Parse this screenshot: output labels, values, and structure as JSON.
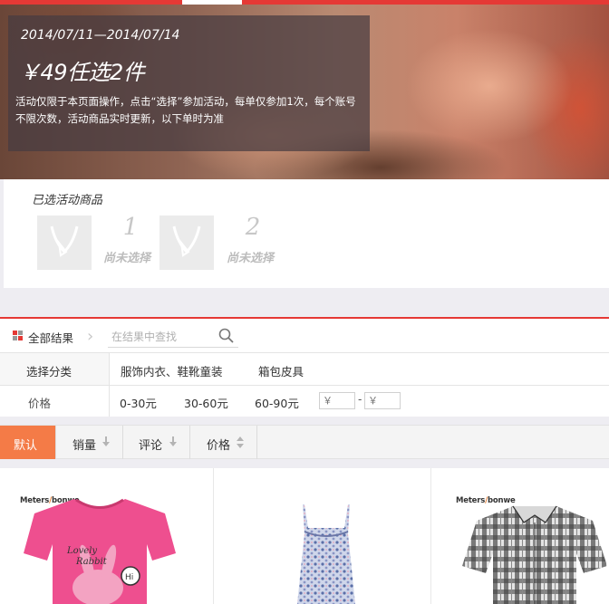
{
  "banner": {
    "date_range": "2014/07/11—2014/07/14",
    "title": "￥49任选2件",
    "description": "活动仅限于本页面操作，点击“选择”参加活动，每单仅参加1次，每个账号不限次数，活动商品实时更新，以下单时为准"
  },
  "selected": {
    "label": "已选活动商品",
    "slots": [
      {
        "number": "1",
        "status": "尚未选择"
      },
      {
        "number": "2",
        "status": "尚未选择"
      }
    ]
  },
  "filter": {
    "all_results": "全部结果",
    "search_placeholder": "在结果中查找",
    "category_label": "选择分类",
    "categories": [
      "服饰内衣、鞋靴童装",
      "箱包皮具"
    ],
    "price_label": "价格",
    "price_ranges": [
      "0-30元",
      "30-60元",
      "60-90元"
    ],
    "price_min_placeholder": "￥",
    "price_max_placeholder": "￥",
    "price_dash": "-"
  },
  "sort": {
    "buttons": [
      {
        "label": "默认",
        "active": true
      },
      {
        "label": "销量",
        "active": false
      },
      {
        "label": "评论",
        "active": false
      },
      {
        "label": "价格",
        "active": false
      }
    ]
  },
  "products": [
    {
      "brand": "Meters/bonwe",
      "item": "pink-t-shirt"
    },
    {
      "brand": "",
      "item": "floral-dress"
    },
    {
      "brand": "Meters/bonwe",
      "item": "plaid-shirt"
    }
  ],
  "colors": {
    "accent_red": "#e53935",
    "sort_active": "#f47b47",
    "brand_orange": "#e87b2b"
  }
}
